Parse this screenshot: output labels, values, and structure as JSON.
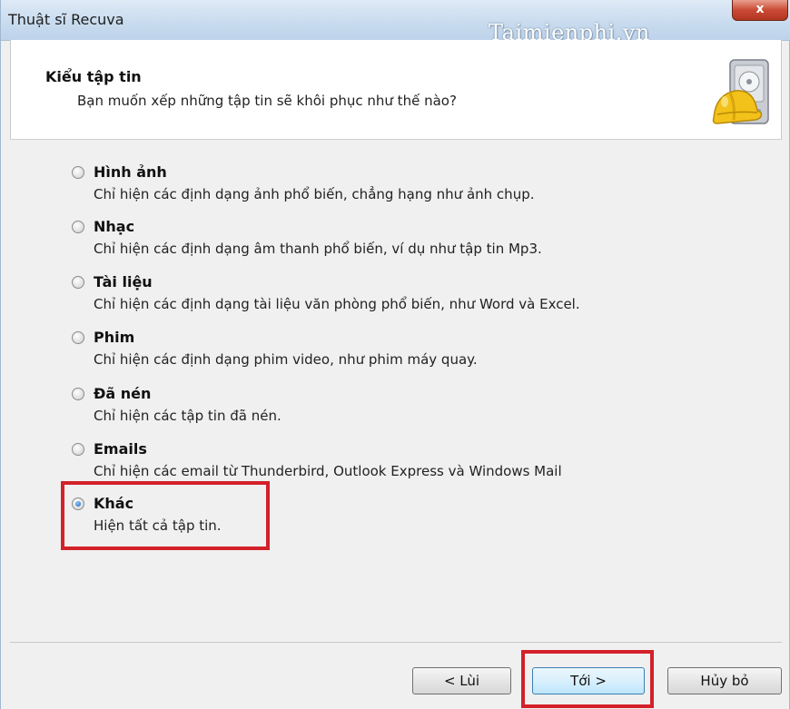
{
  "window": {
    "title": "Thuật sĩ Recuva",
    "watermark": "Taimienphi.vn",
    "close_label": "x"
  },
  "header": {
    "title": "Kiểu tập tin",
    "subtitle": "Bạn muốn xếp những tập tin sẽ khôi phục như thế nào?",
    "icon": "recuva-hardhat-drive-icon"
  },
  "options": [
    {
      "label": "Hình ảnh",
      "description": "Chỉ hiện các định dạng ảnh phổ biến, chẳng hạng như ảnh chụp.",
      "checked": false
    },
    {
      "label": "Nhạc",
      "description": "Chỉ hiện các định dạng âm thanh phổ biến, ví dụ như tập tin Mp3.",
      "checked": false
    },
    {
      "label": "Tài liệu",
      "description": "Chỉ hiện các định dạng tài liệu văn phòng phổ biến, như Word và Excel.",
      "checked": false
    },
    {
      "label": "Phim",
      "description": "Chỉ hiện các định dạng phim video, như phim máy quay.",
      "checked": false
    },
    {
      "label": "Đã nén",
      "description": "Chỉ hiện các tập tin đã nén.",
      "checked": false
    },
    {
      "label": "Emails",
      "description": "Chỉ hiện các email từ Thunderbird, Outlook Express và Windows Mail",
      "checked": false
    },
    {
      "label": "Khác",
      "description": "Hiện tất cả tập tin.",
      "checked": true
    }
  ],
  "buttons": {
    "back": "< Lùi",
    "next": "Tới >",
    "cancel": "Hủy bỏ"
  },
  "colors": {
    "highlight": "#d3212a",
    "accent": "#1c5fb0"
  }
}
